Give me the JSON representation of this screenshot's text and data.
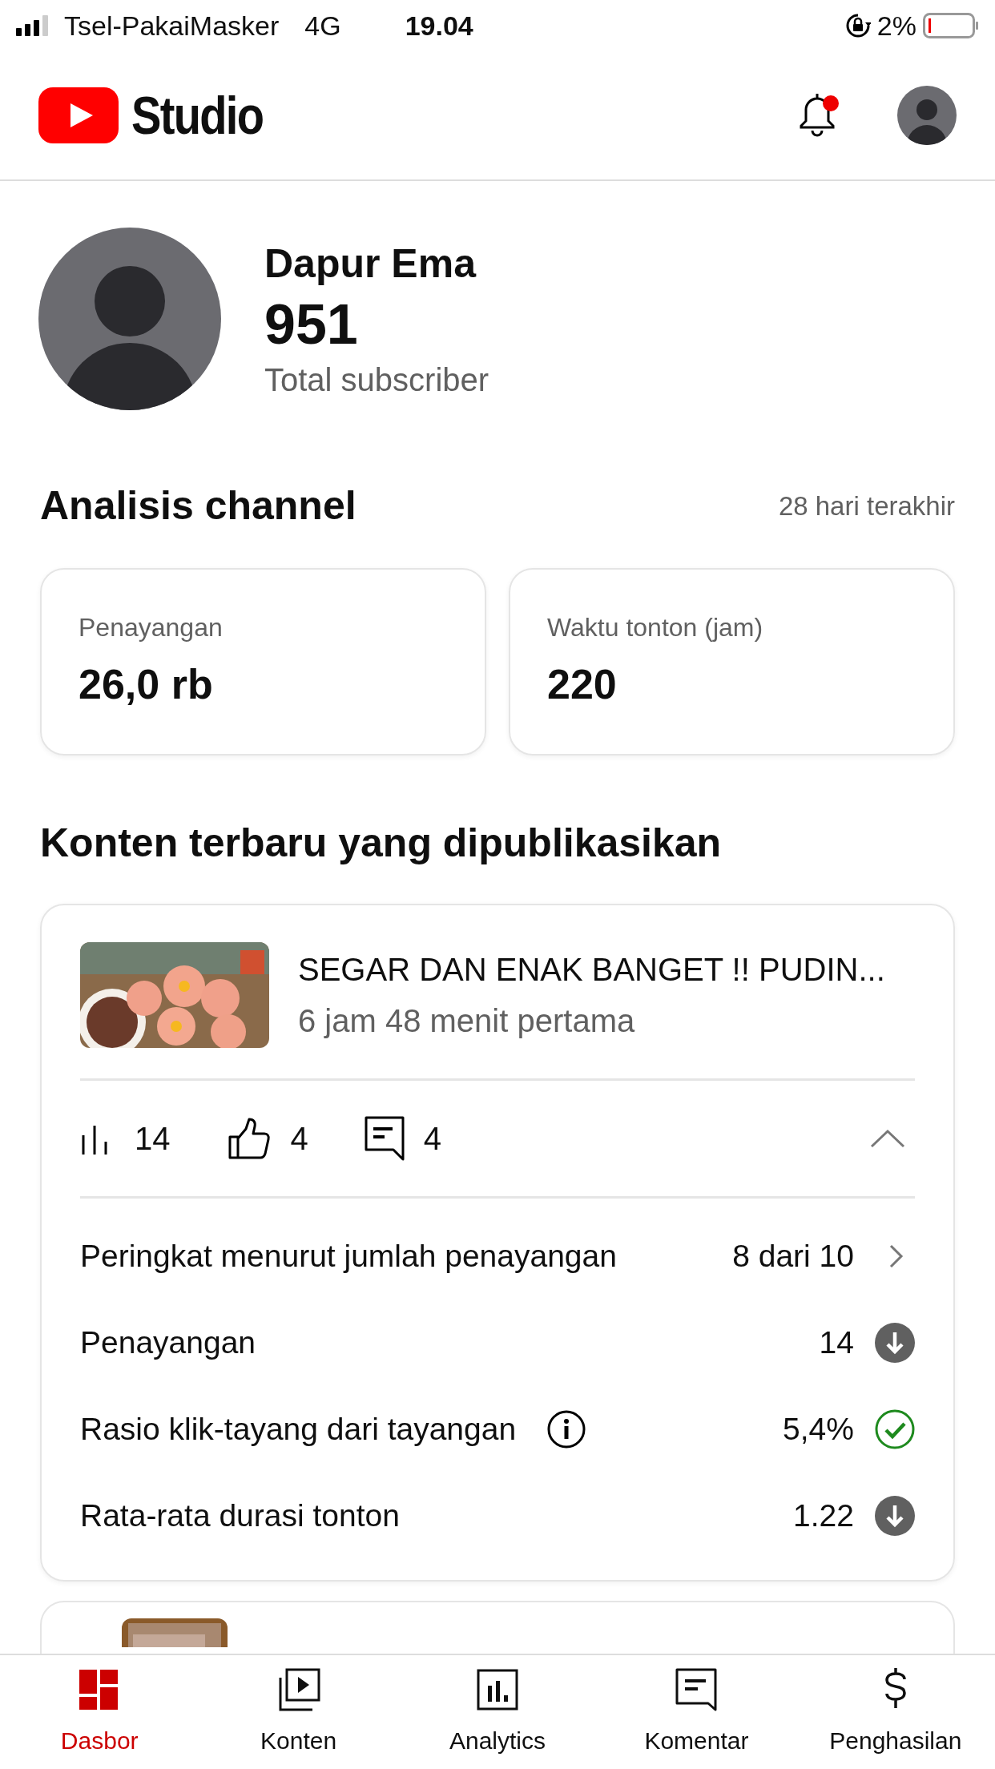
{
  "status_bar": {
    "carrier": "Tsel-PakaiMasker",
    "network": "4G",
    "time": "19.04",
    "battery": "2%"
  },
  "header": {
    "logo_text": "Studio",
    "notification_dot": true
  },
  "channel": {
    "name": "Dapur Ema",
    "subscribers": "951",
    "subscribers_label": "Total subscriber"
  },
  "analytics": {
    "title": "Analisis channel",
    "period": "28 hari terakhir",
    "cards": [
      {
        "label": "Penayangan",
        "value": "26,0 rb"
      },
      {
        "label": "Waktu tonton (jam)",
        "value": "220"
      }
    ]
  },
  "recent": {
    "title": "Konten terbaru yang dipublikasikan",
    "video": {
      "title": "SEGAR DAN ENAK BANGET !! PUDIN...",
      "subtitle": "6 jam 48 menit pertama",
      "views": "14",
      "likes": "4",
      "comments": "4",
      "expanded": true,
      "metrics": [
        {
          "label": "Peringkat menurut jumlah penayangan",
          "value": "8 dari 10",
          "info": false,
          "kind": "chevron"
        },
        {
          "label": "Penayangan",
          "value": "14",
          "info": false,
          "kind": "down"
        },
        {
          "label": "Rasio klik-tayang dari tayangan",
          "value": "5,4%",
          "info": true,
          "kind": "check"
        },
        {
          "label": "Rata-rata durasi tonton",
          "value": "1.22",
          "info": false,
          "kind": "down"
        }
      ]
    }
  },
  "bottom_nav": [
    {
      "label": "Dasbor",
      "kind": "dashboard",
      "selected": true
    },
    {
      "label": "Konten",
      "kind": "content",
      "selected": false
    },
    {
      "label": "Analytics",
      "kind": "analytics",
      "selected": false
    },
    {
      "label": "Komentar",
      "kind": "comments",
      "selected": false
    },
    {
      "label": "Penghasilan",
      "kind": "money",
      "selected": false
    }
  ]
}
